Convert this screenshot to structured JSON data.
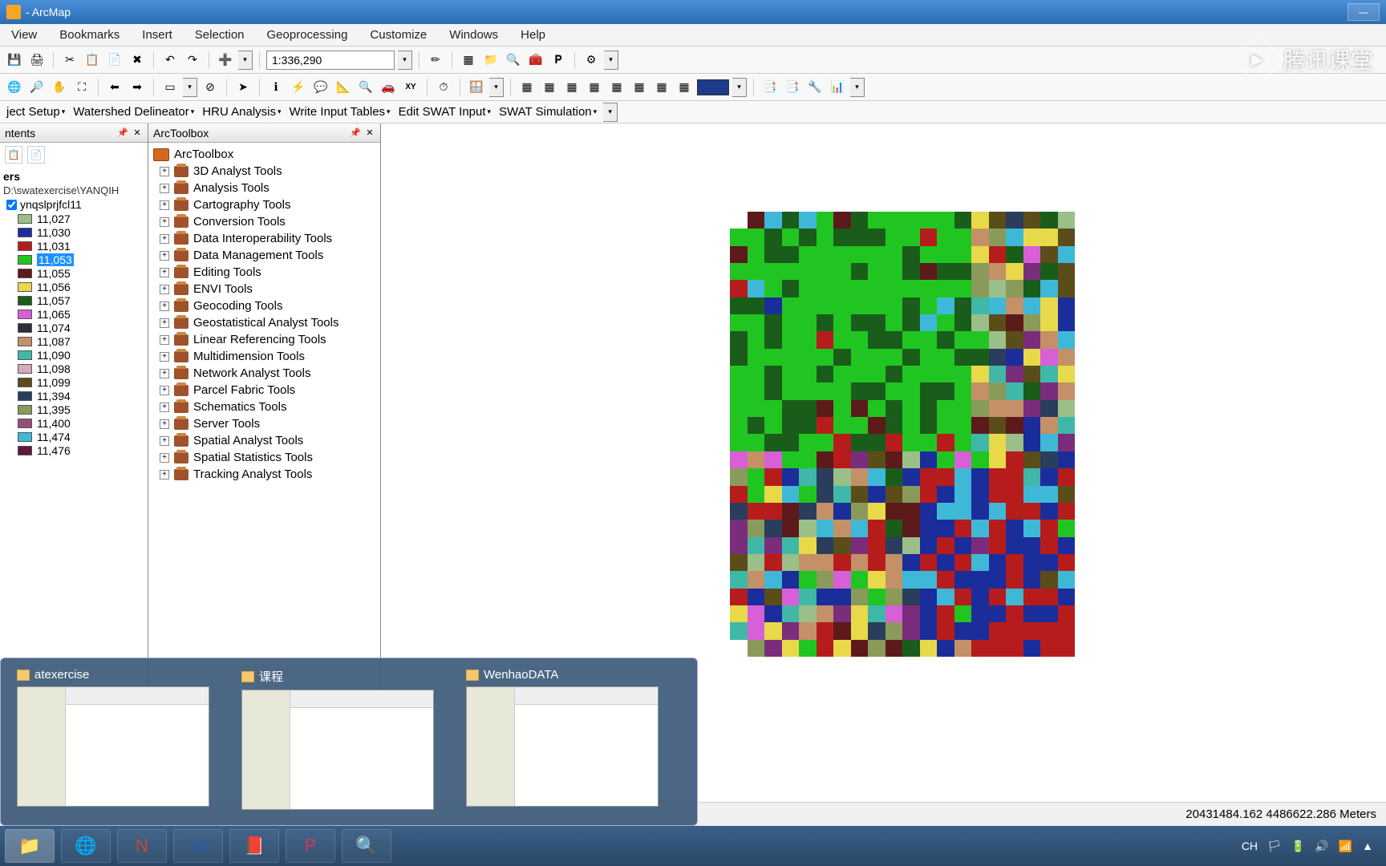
{
  "titlebar": {
    "title": "- ArcMap"
  },
  "menubar": [
    "View",
    "Bookmarks",
    "Insert",
    "Selection",
    "Geoprocessing",
    "Customize",
    "Windows",
    "Help"
  ],
  "toolbar1": {
    "scale": "1:336,290"
  },
  "swat_menu": [
    "ject Setup",
    "Watershed Delineator",
    "HRU Analysis",
    "Write Input Tables",
    "Edit SWAT Input",
    "SWAT Simulation"
  ],
  "toc": {
    "panel_title": "ntents",
    "layers_label": "ers",
    "path": "D:\\swatexercise\\YANQIH",
    "layer_name": "ynqslprjfcl11",
    "legend": [
      {
        "v": "11,027",
        "c": "#9bbf88"
      },
      {
        "v": "11,030",
        "c": "#1b2d9b"
      },
      {
        "v": "11,031",
        "c": "#b71c1c"
      },
      {
        "v": "11,053",
        "c": "#21c521",
        "sel": true
      },
      {
        "v": "11,055",
        "c": "#5d1a1a"
      },
      {
        "v": "11,056",
        "c": "#e8d94a"
      },
      {
        "v": "11,057",
        "c": "#1a5d1a"
      },
      {
        "v": "11,065",
        "c": "#d85fd8"
      },
      {
        "v": "11,074",
        "c": "#2e2e3a"
      },
      {
        "v": "11,087",
        "c": "#c49068"
      },
      {
        "v": "11,090",
        "c": "#3fb8a8"
      },
      {
        "v": "11,098",
        "c": "#d8a8c0"
      },
      {
        "v": "11,099",
        "c": "#5a4d1a"
      },
      {
        "v": "11,394",
        "c": "#2a3d5d"
      },
      {
        "v": "11,395",
        "c": "#8a9a5a"
      },
      {
        "v": "11,400",
        "c": "#9b4d7a"
      },
      {
        "v": "11,474",
        "c": "#3fb8d8"
      },
      {
        "v": "11,476",
        "c": "#5d1a3d"
      }
    ]
  },
  "toolbox": {
    "panel_title": "ArcToolbox",
    "root": "ArcToolbox",
    "items": [
      "3D Analyst Tools",
      "Analysis Tools",
      "Cartography Tools",
      "Conversion Tools",
      "Data Interoperability Tools",
      "Data Management Tools",
      "Editing Tools",
      "ENVI Tools",
      "Geocoding Tools",
      "Geostatistical Analyst Tools",
      "Linear Referencing Tools",
      "Multidimension Tools",
      "Network Analyst Tools",
      "Parcel Fabric Tools",
      "Schematics Tools",
      "Server Tools",
      "Spatial Analyst Tools",
      "Spatial Statistics Tools",
      "Tracking Analyst Tools"
    ]
  },
  "statusbar": {
    "coords": "20431484.162  4486622.286 Meters"
  },
  "thumbs": [
    {
      "title": "atexercise"
    },
    {
      "title": "课程"
    },
    {
      "title": "WenhaoDATA"
    }
  ],
  "watermark": "腾讯课堂",
  "tray": {
    "ime": "CH"
  }
}
